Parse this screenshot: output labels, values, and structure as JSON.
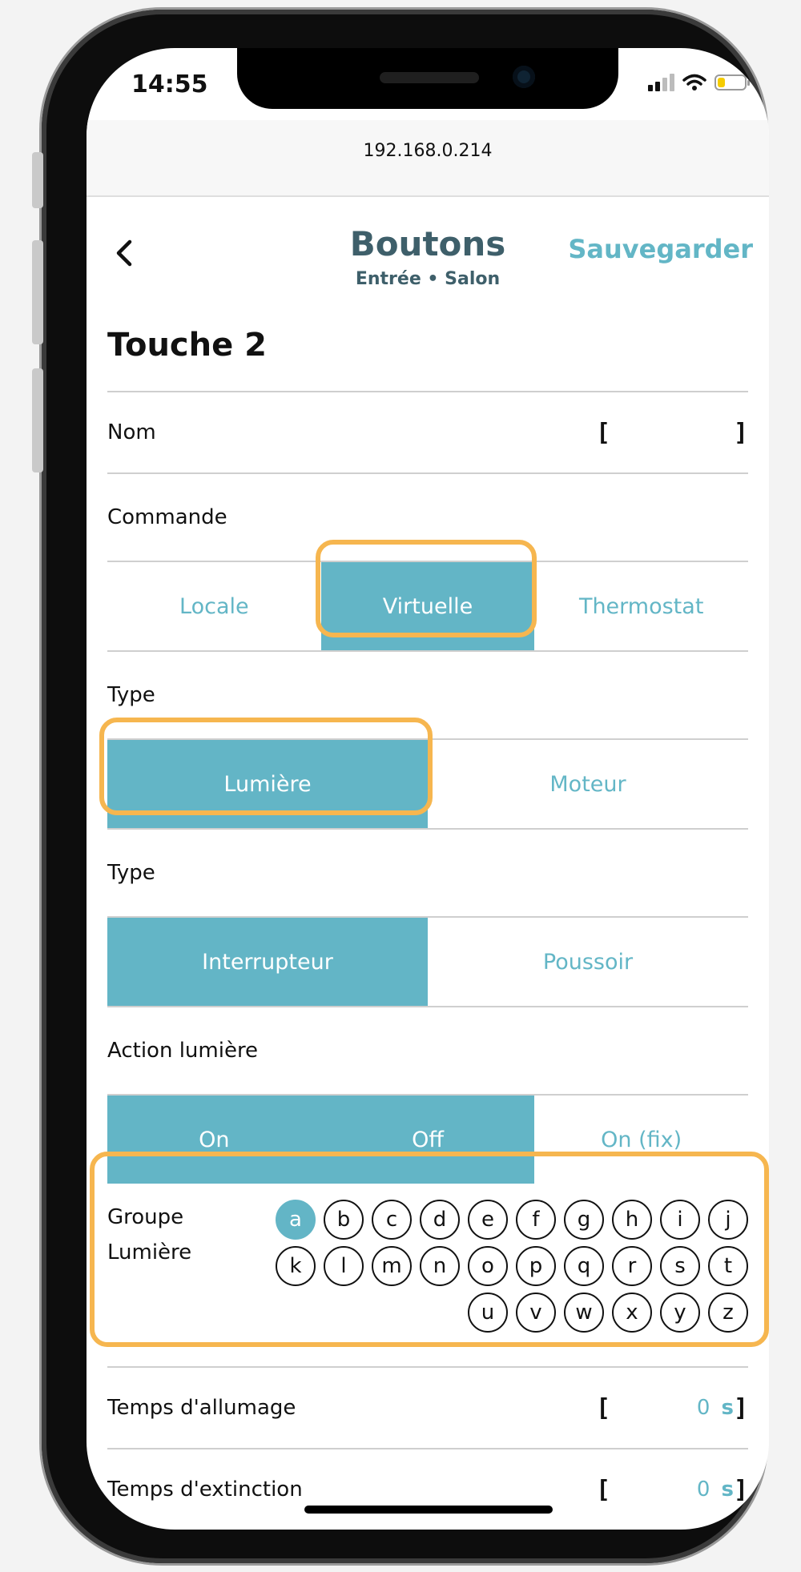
{
  "status_bar": {
    "time": "14:55"
  },
  "browser": {
    "url": "192.168.0.214"
  },
  "header": {
    "back_icon": "chevron-left-icon",
    "title": "Boutons",
    "subtitle": "Entrée • Salon",
    "save_label": "Sauvegarder"
  },
  "page": {
    "title": "Touche 2"
  },
  "nom": {
    "label": "Nom",
    "open": "[",
    "value": "",
    "close": "]"
  },
  "commande": {
    "label": "Commande",
    "options": [
      "Locale",
      "Virtuelle",
      "Thermostat"
    ],
    "selected": "Virtuelle"
  },
  "type1": {
    "label": "Type",
    "options": [
      "Lumière",
      "Moteur"
    ],
    "selected": "Lumière"
  },
  "type2": {
    "label": "Type",
    "options": [
      "Interrupteur",
      "Poussoir"
    ],
    "selected": "Interrupteur"
  },
  "action": {
    "label": "Action lumière",
    "options": [
      "On",
      "Off",
      "On (fix)"
    ],
    "selected": [
      "On",
      "Off"
    ]
  },
  "groupe": {
    "label_line1": "Groupe",
    "label_line2": "Lumière",
    "letters": [
      "a",
      "b",
      "c",
      "d",
      "e",
      "f",
      "g",
      "h",
      "i",
      "j",
      "k",
      "l",
      "m",
      "n",
      "o",
      "p",
      "q",
      "r",
      "s",
      "t",
      "u",
      "v",
      "w",
      "x",
      "y",
      "z"
    ],
    "selected": "a"
  },
  "allumage": {
    "label": "Temps d'allumage",
    "open": "[",
    "value": "0",
    "unit": "s",
    "close": "]"
  },
  "extinction": {
    "label": "Temps d'extinction",
    "open": "[",
    "value": "0",
    "unit": "s",
    "close": "]"
  },
  "colors": {
    "accent": "#63b5c6",
    "header_text": "#3e5f6a",
    "highlight": "#f6b64f"
  }
}
